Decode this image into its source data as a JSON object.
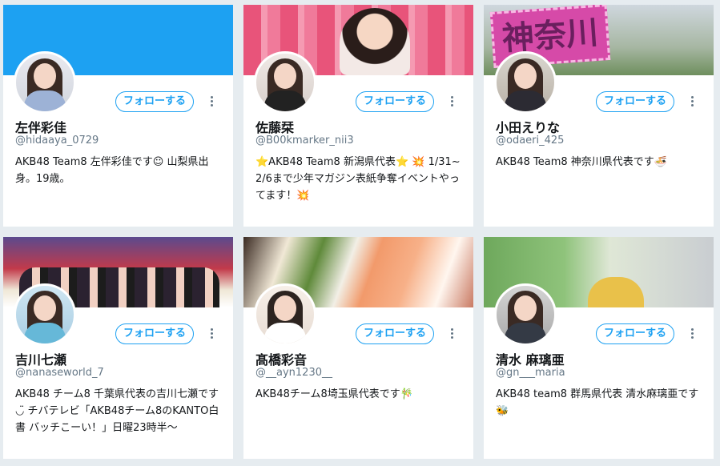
{
  "follow_label": "フォローする",
  "accent_color": "#1da1f2",
  "cards": [
    {
      "name": "左伴彩佳",
      "handle": "@hidaaya_0729",
      "bio": "AKB48 Team8 左伴彩佳です☺ 山梨県出身。19歳。"
    },
    {
      "name": "佐藤栞",
      "handle": "@B00kmarker_nii3",
      "bio": "⭐AKB48 Team8 新潟県代表⭐ 💥 1/31~2/6まで少年マガジン表紙争奪イベントやってます！💥"
    },
    {
      "name": "小田えりな",
      "handle": "@odaeri_425",
      "bio": "AKB48 Team8 神奈川県代表です🍜"
    },
    {
      "name": "吉川七瀬",
      "handle": "@nanaseworld_7",
      "bio": "AKB48 チーム8 千葉県代表の吉川七瀬です◡̈ チバテレビ「AKB48チーム8のKANTO白書 バッチこーい！」日曜23時半〜"
    },
    {
      "name": "髙橋彩音",
      "handle": "@__ayn1230__",
      "bio": "AKB48チーム8埼玉県代表です🎋"
    },
    {
      "name": "清水 麻璃亜",
      "handle": "@gn___maria",
      "bio": "AKB48 team8 群馬県代表 清水麻璃亜です🐝"
    }
  ],
  "banners": {
    "card3_sign_text": "神奈川"
  }
}
